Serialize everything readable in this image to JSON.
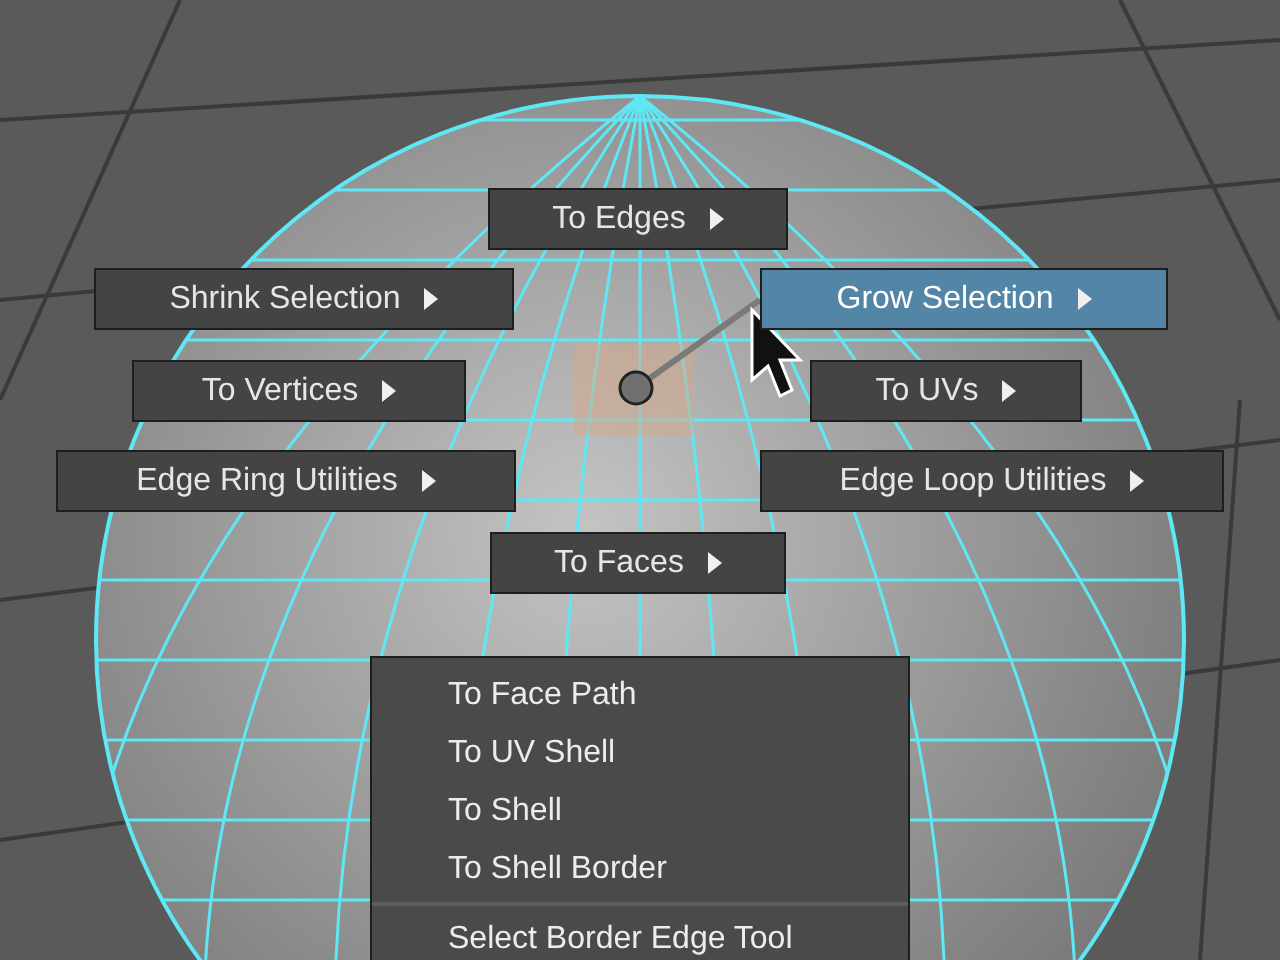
{
  "marking_menu": [
    {
      "label": "To Edges",
      "selected": false
    },
    {
      "label": "Shrink Selection",
      "selected": false
    },
    {
      "label": "Grow Selection",
      "selected": true
    },
    {
      "label": "To Vertices",
      "selected": false
    },
    {
      "label": "To UVs",
      "selected": false
    },
    {
      "label": "Edge Ring Utilities",
      "selected": false
    },
    {
      "label": "Edge Loop Utilities",
      "selected": false
    },
    {
      "label": "To Faces",
      "selected": false
    }
  ],
  "context_menu": [
    {
      "label": "To Face Path",
      "kind": "item"
    },
    {
      "label": "To UV Shell",
      "kind": "item"
    },
    {
      "label": "To Shell",
      "kind": "item"
    },
    {
      "label": "To Shell Border",
      "kind": "item"
    },
    {
      "kind": "separator"
    },
    {
      "label": "Select Border Edge Tool",
      "kind": "item"
    }
  ]
}
